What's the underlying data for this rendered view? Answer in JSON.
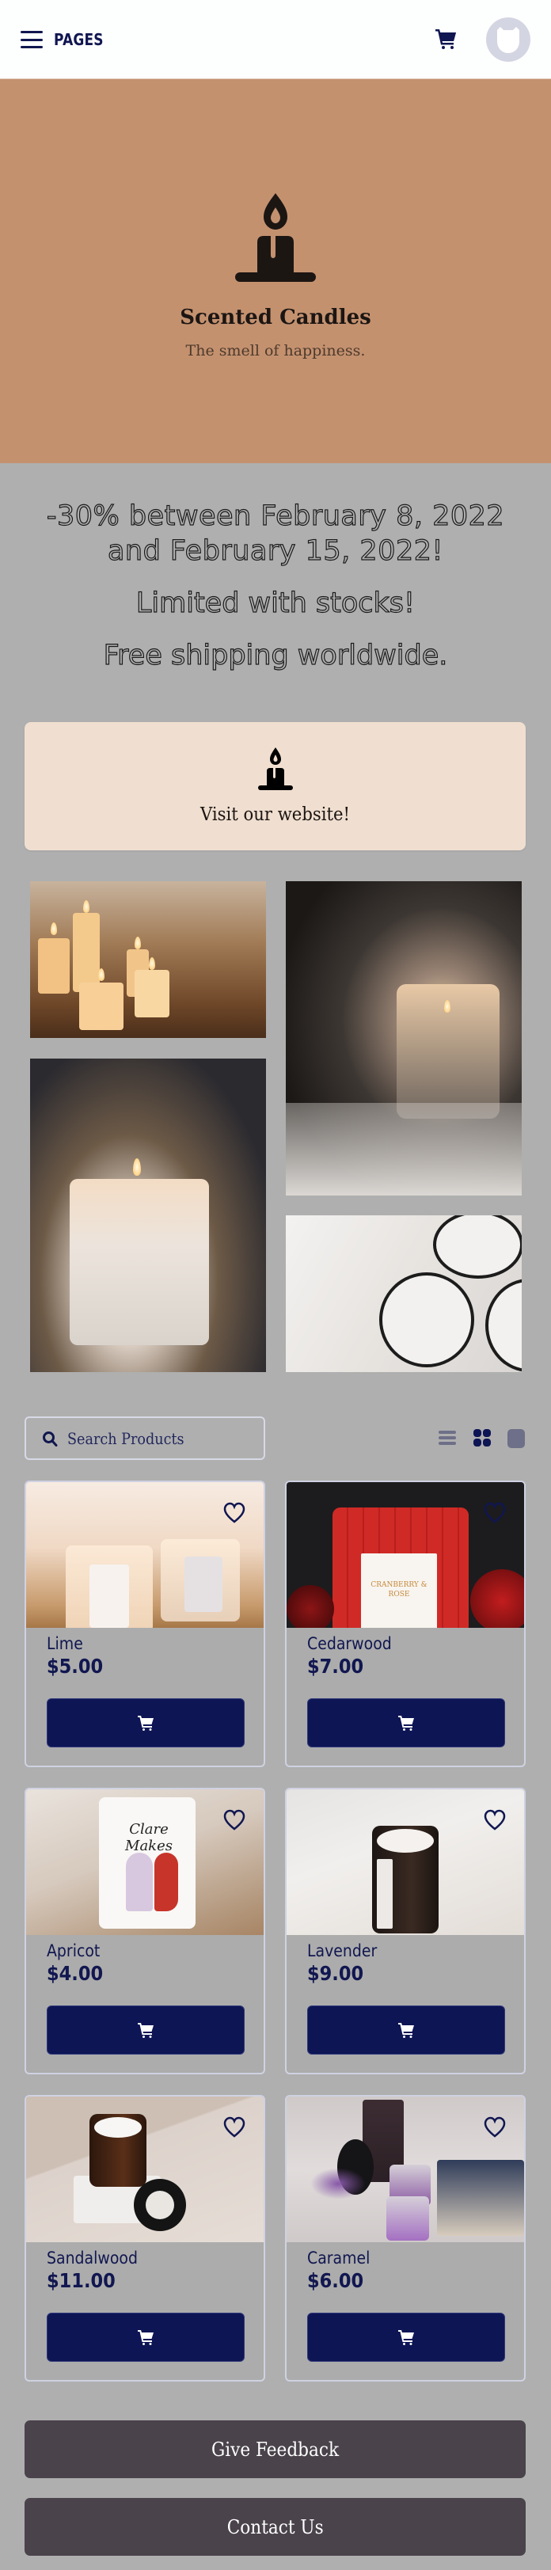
{
  "header": {
    "menu_label": "PAGES",
    "icons": [
      "hamburger-menu-icon",
      "shopping-cart-icon",
      "avatar-icon"
    ]
  },
  "hero": {
    "icon": "candle-icon",
    "title": "Scented Candles",
    "subtitle": "The smell of happiness.",
    "background_color": "#C4916F"
  },
  "promo": {
    "line1": "-30% between February 8, 2022 and February 15, 2022!",
    "line2": "Limited with stocks!",
    "line3": "Free shipping worldwide."
  },
  "visit_card": {
    "icon": "candle-icon",
    "label": "Visit our website!",
    "background_color": "#F0DFD0"
  },
  "gallery": {
    "images": [
      {
        "description": "Lit pillar candles with dried leaves"
      },
      {
        "description": "Candle in glass jar with fur and fairy lights"
      },
      {
        "description": "Candle in glass with autumn leaves"
      },
      {
        "description": "Three white candles in black-rimmed tins from above"
      }
    ]
  },
  "shop": {
    "search_placeholder": "Search Products",
    "view_modes": [
      {
        "name": "list",
        "icon": "list-view-icon",
        "active": false
      },
      {
        "name": "grid",
        "icon": "grid-view-icon",
        "active": true
      },
      {
        "name": "single",
        "icon": "single-view-icon",
        "active": false
      }
    ],
    "products": [
      {
        "name": "Lime",
        "price": "$5.00"
      },
      {
        "name": "Cedarwood",
        "price": "$7.00"
      },
      {
        "name": "Apricot",
        "price": "$4.00"
      },
      {
        "name": "Lavender",
        "price": "$9.00"
      },
      {
        "name": "Sandalwood",
        "price": "$11.00"
      },
      {
        "name": "Caramel",
        "price": "$6.00"
      }
    ],
    "accent_color": "#0D1555"
  },
  "footer_buttons": {
    "feedback_label": "Give Feedback",
    "contact_label": "Contact Us",
    "button_color": "#4A434B"
  }
}
